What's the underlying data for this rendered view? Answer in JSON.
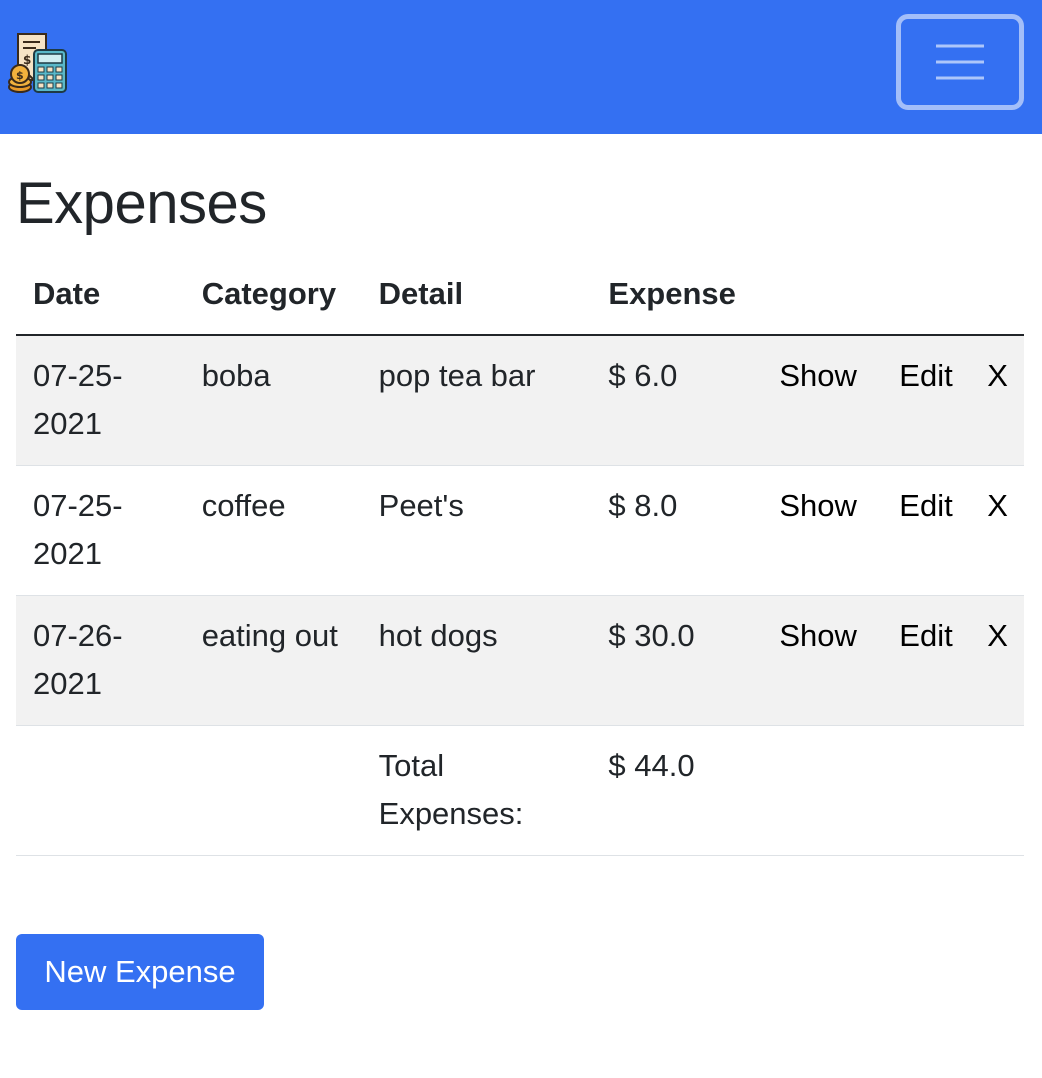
{
  "navbar": {
    "brand_icon": "calculator-receipt-coins-icon",
    "toggler_icon": "hamburger-menu-icon",
    "background": "#3470f2"
  },
  "page": {
    "title": "Expenses"
  },
  "table": {
    "headers": {
      "date": "Date",
      "category": "Category",
      "detail": "Detail",
      "expense": "Expense"
    },
    "rows": [
      {
        "date": "07-25-2021",
        "category": "boba",
        "detail": "pop tea bar",
        "expense": "$ 6.0",
        "show": "Show",
        "edit": "Edit",
        "delete": "X"
      },
      {
        "date": "07-25-2021",
        "category": "coffee",
        "detail": "Peet's",
        "expense": "$ 8.0",
        "show": "Show",
        "edit": "Edit",
        "delete": "X"
      },
      {
        "date": "07-26-2021",
        "category": "eating out",
        "detail": "hot dogs",
        "expense": "$ 30.0",
        "show": "Show",
        "edit": "Edit",
        "delete": "X"
      }
    ],
    "total": {
      "label": "Total Expenses:",
      "value": "$ 44.0"
    }
  },
  "actions": {
    "new_expense_label": "New Expense",
    "accent": "#3470f2"
  }
}
